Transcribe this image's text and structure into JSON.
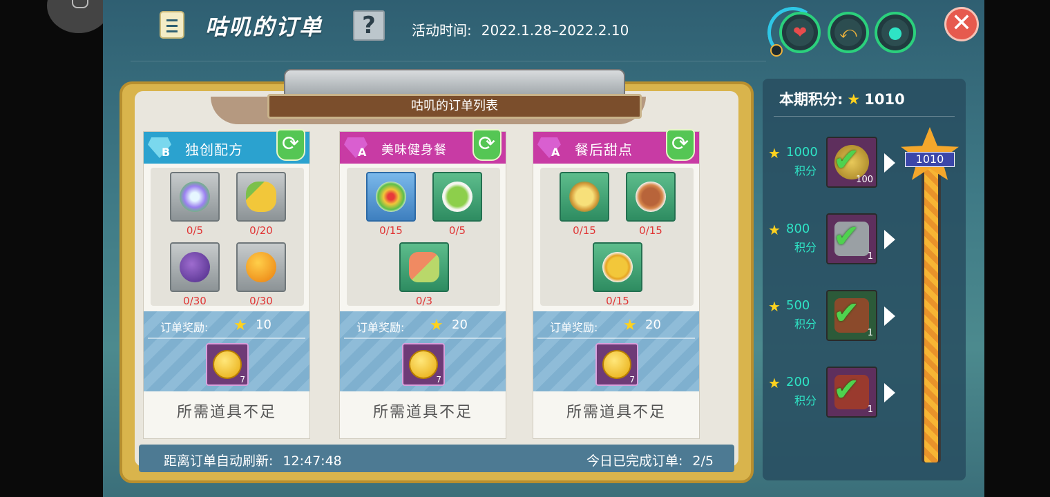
{
  "header": {
    "title": "咕叽的订单",
    "help_symbol": "?",
    "event_label": "活动时间:",
    "event_range": "2022.1.28–2022.2.10",
    "close_symbol": "✕"
  },
  "status_icons": [
    {
      "name": "heart",
      "glyph": "❤",
      "color": "#e74c4c"
    },
    {
      "name": "stamina",
      "glyph": "💪",
      "color": "#f0b43c"
    },
    {
      "name": "water",
      "glyph": "💧",
      "color": "#2ee4c5"
    }
  ],
  "board": {
    "title": "咕叽的订单列表",
    "orders": [
      {
        "grade": "B",
        "name": "独创配方",
        "items": [
          {
            "icon": "flower-icon",
            "count": "0/5"
          },
          {
            "icon": "corn-icon",
            "count": "0/20"
          },
          {
            "icon": "grape-icon",
            "count": "0/30"
          },
          {
            "icon": "orange-icon",
            "count": "0/30"
          }
        ],
        "reward_label": "订单奖励:",
        "reward_points": "10",
        "reward_item_qty": "7",
        "status": "所需道具不足"
      },
      {
        "grade": "A",
        "name": "美味健身餐",
        "items": [
          {
            "icon": "fruit-salad-icon",
            "count": "0/15"
          },
          {
            "icon": "green-soup-icon",
            "count": "0/5"
          },
          {
            "icon": "salmon-dish-icon",
            "count": "0/3"
          }
        ],
        "reward_label": "订单奖励:",
        "reward_points": "20",
        "reward_item_qty": "7",
        "status": "所需道具不足"
      },
      {
        "grade": "A",
        "name": "餐后甜点",
        "items": [
          {
            "icon": "egg-tart-icon",
            "count": "0/15"
          },
          {
            "icon": "pancake-icon",
            "count": "0/15"
          },
          {
            "icon": "honey-cubes-icon",
            "count": "0/15"
          }
        ],
        "reward_label": "订单奖励:",
        "reward_points": "20",
        "reward_item_qty": "7",
        "status": "所需道具不足"
      }
    ],
    "refresh_label": "距离订单自动刷新:",
    "refresh_time": "12:47:48",
    "completed_label": "今日已完成订单:",
    "completed_count": "2/5"
  },
  "points": {
    "label": "本期积分:",
    "value": "1010",
    "milestones": [
      {
        "value": "1000",
        "unit": "积分",
        "qty": "100",
        "claimed": true
      },
      {
        "value": "800",
        "unit": "积分",
        "qty": "1",
        "claimed": true
      },
      {
        "value": "500",
        "unit": "积分",
        "qty": "1",
        "claimed": true
      },
      {
        "value": "200",
        "unit": "积分",
        "qty": "1",
        "claimed": true
      }
    ],
    "progress_fraction": 1.0
  }
}
